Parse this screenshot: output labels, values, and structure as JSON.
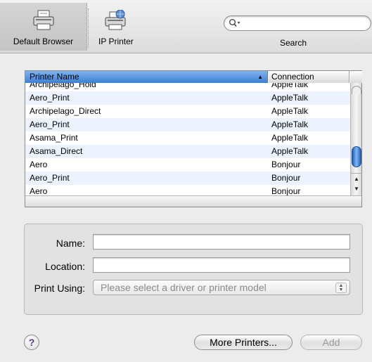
{
  "toolbar": {
    "default_browser_label": "Default Browser",
    "ip_printer_label": "IP Printer",
    "search_label": "Search",
    "search_value": ""
  },
  "table": {
    "columns": {
      "name": "Printer Name",
      "connection": "Connection"
    },
    "sort_indicator": "▲",
    "rows": [
      {
        "name": "Archipelago_Hold",
        "connection": "AppleTalk"
      },
      {
        "name": "Aero_Print",
        "connection": "AppleTalk"
      },
      {
        "name": "Archipelago_Direct",
        "connection": "AppleTalk"
      },
      {
        "name": "Aero_Print",
        "connection": "AppleTalk"
      },
      {
        "name": "Asama_Print",
        "connection": "AppleTalk"
      },
      {
        "name": "Asama_Direct",
        "connection": "AppleTalk"
      },
      {
        "name": "Aero",
        "connection": "Bonjour"
      },
      {
        "name": "Aero_Print",
        "connection": "Bonjour"
      },
      {
        "name": "Aero",
        "connection": "Bonjour"
      }
    ]
  },
  "form": {
    "name_label": "Name:",
    "name_value": "",
    "location_label": "Location:",
    "location_value": "",
    "print_using_label": "Print Using:",
    "print_using_value": "Please select a driver or printer model"
  },
  "buttons": {
    "help": "?",
    "more_printers": "More Printers...",
    "add": "Add"
  },
  "colors": {
    "header_selected": "#3c7fd6",
    "row_alt": "#edf3fe",
    "scroll_thumb": "#1f5fb8",
    "help_glyph": "#5a2e9a"
  }
}
